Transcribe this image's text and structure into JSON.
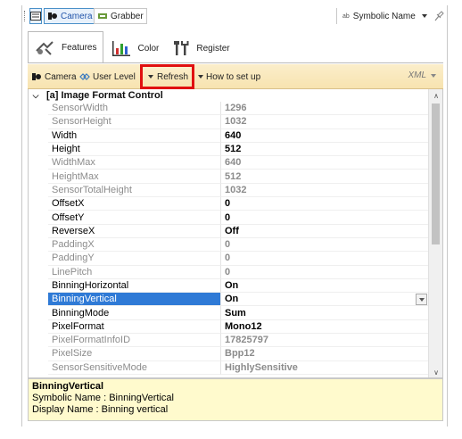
{
  "toolbar": {
    "camera_label": "Camera",
    "grabber_label": "Grabber",
    "symbolic_label": "Symbolic Name",
    "symbolic_prefix": "ab"
  },
  "tabs": [
    {
      "label": "Features",
      "active": true
    },
    {
      "label": "Color",
      "active": false
    },
    {
      "label": "Register",
      "active": false
    }
  ],
  "grid_toolbar": {
    "camera": "Camera",
    "user_level": "User Level",
    "refresh": "Refresh",
    "how_to": "How to set up",
    "xml": "XML"
  },
  "category": "[a] Image Format Control",
  "properties": [
    {
      "name": "SensorWidth",
      "value": "1296",
      "readonly": true
    },
    {
      "name": "SensorHeight",
      "value": "1032",
      "readonly": true
    },
    {
      "name": "Width",
      "value": "640",
      "readonly": false
    },
    {
      "name": "Height",
      "value": "512",
      "readonly": false
    },
    {
      "name": "WidthMax",
      "value": "640",
      "readonly": true
    },
    {
      "name": "HeightMax",
      "value": "512",
      "readonly": true
    },
    {
      "name": "SensorTotalHeight",
      "value": "1032",
      "readonly": true
    },
    {
      "name": "OffsetX",
      "value": "0",
      "readonly": false
    },
    {
      "name": "OffsetY",
      "value": "0",
      "readonly": false
    },
    {
      "name": "ReverseX",
      "value": "Off",
      "readonly": false
    },
    {
      "name": "PaddingX",
      "value": "0",
      "readonly": true
    },
    {
      "name": "PaddingY",
      "value": "0",
      "readonly": true
    },
    {
      "name": "LinePitch",
      "value": "0",
      "readonly": true
    },
    {
      "name": "BinningHorizontal",
      "value": "On",
      "readonly": false
    },
    {
      "name": "BinningVertical",
      "value": "On",
      "readonly": false,
      "selected": true
    },
    {
      "name": "BinningMode",
      "value": "Sum",
      "readonly": false
    },
    {
      "name": "PixelFormat",
      "value": "Mono12",
      "readonly": false
    },
    {
      "name": "PixelFormatInfoID",
      "value": "17825797",
      "readonly": true
    },
    {
      "name": "PixelSize",
      "value": "Bpp12",
      "readonly": true
    },
    {
      "name": "SensorSensitiveMode",
      "value": "HighlySensitive",
      "readonly": true
    }
  ],
  "description": {
    "title": "BinningVertical",
    "symbolic": "Symbolic Name : BinningVertical",
    "display": "Display  Name : Binning vertical"
  },
  "colors": {
    "selection": "#2f7ad6",
    "toolbar_bg": "#f7e3b0",
    "highlight_box": "#e01010",
    "desc_bg": "#fffacd"
  }
}
